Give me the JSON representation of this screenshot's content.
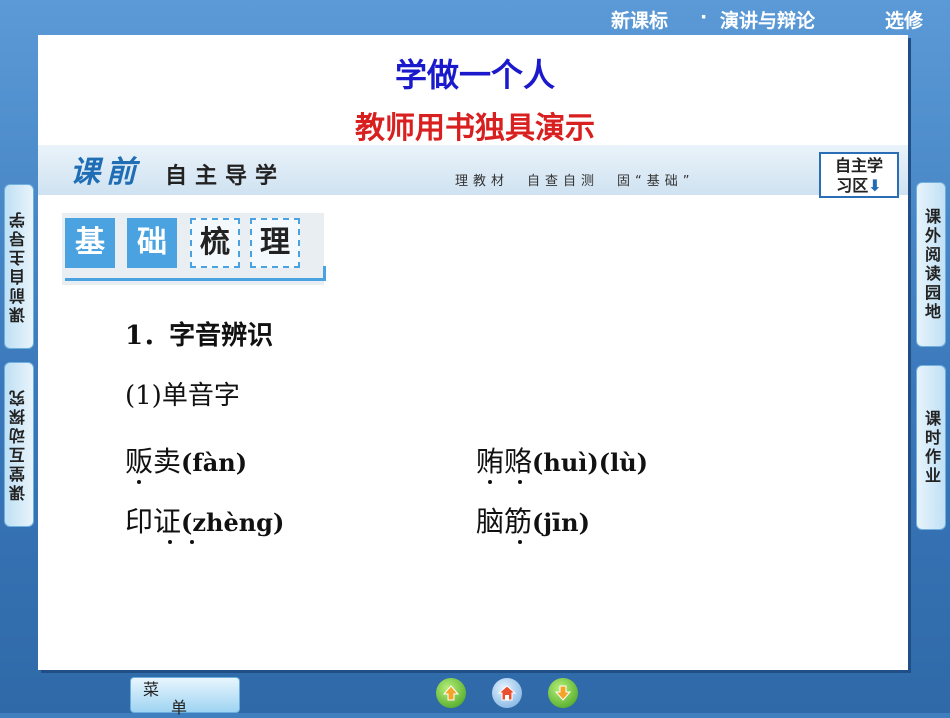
{
  "header": {
    "course": "新课标",
    "separator": "·",
    "subject": "演讲与辩论",
    "edition": "选修"
  },
  "slide": {
    "title": "学做一个人",
    "subtitle": "教师用书独具演示",
    "banner": {
      "ke": "课前",
      "label": "自主导学",
      "tagline": "理教材　自查自测　固“基础”",
      "zone_button": {
        "line1": "自主学",
        "line2": "习区"
      }
    },
    "section_badge": {
      "part1": "基",
      "part2": "础",
      "part3": "梳",
      "part4": "理"
    },
    "heading": "1．字音辨识",
    "subheading": "(1)单音字",
    "items": [
      {
        "hanzi": "贩卖",
        "pinyin": "(fàn)"
      },
      {
        "hanzi": "贿赂",
        "pinyin": "(huì)(lù)"
      },
      {
        "hanzi": "印证",
        "pinyin": "(zhèng)"
      },
      {
        "hanzi": "脑筋",
        "pinyin": "(jīn)"
      }
    ]
  },
  "left_tabs": [
    "课前自主导学",
    "课堂互动探究"
  ],
  "right_tabs": [
    "课外阅读园地",
    "课时作业"
  ],
  "bottom": {
    "menu_1": "菜",
    "menu_2": "单"
  },
  "colors": {
    "title": "#1a1acc",
    "subtitle": "#d82020",
    "accent": "#4aa3e0"
  }
}
